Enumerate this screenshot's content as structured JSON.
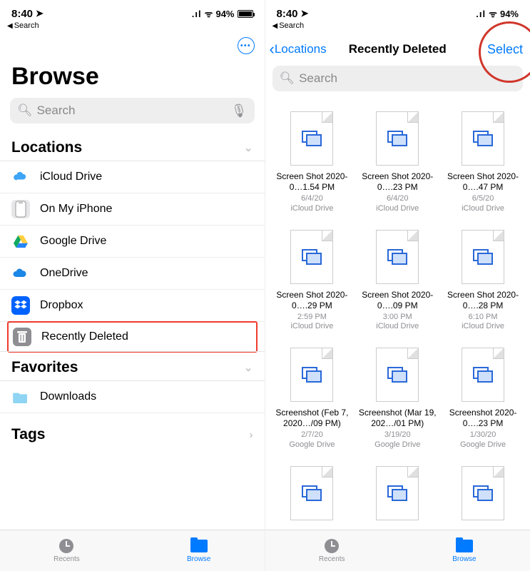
{
  "status": {
    "time": "8:40",
    "back_label": "Search",
    "signal_text": "94%",
    "wifi_glyph": "●",
    "location_glyph": "➤"
  },
  "left": {
    "title": "Browse",
    "search_placeholder": "Search",
    "sections": {
      "locations_title": "Locations",
      "favorites_title": "Favorites",
      "tags_title": "Tags"
    },
    "locations": [
      {
        "label": "iCloud Drive",
        "icon": "cloud"
      },
      {
        "label": "On My iPhone",
        "icon": "phone"
      },
      {
        "label": "Google Drive",
        "icon": "gdrive"
      },
      {
        "label": "OneDrive",
        "icon": "onedrive"
      },
      {
        "label": "Dropbox",
        "icon": "dropbox"
      },
      {
        "label": "Recently Deleted",
        "icon": "trash",
        "highlight": true
      }
    ],
    "favorites": [
      {
        "label": "Downloads",
        "icon": "folder"
      }
    ]
  },
  "right": {
    "back_label": "Locations",
    "title": "Recently Deleted",
    "select_label": "Select",
    "search_placeholder": "Search",
    "files": [
      {
        "name": "Screen Shot 2020-0…1.54 PM",
        "date": "6/4/20",
        "source": "iCloud Drive"
      },
      {
        "name": "Screen Shot 2020-0….23 PM",
        "date": "6/4/20",
        "source": "iCloud Drive"
      },
      {
        "name": "Screen Shot 2020-0….47 PM",
        "date": "6/5/20",
        "source": "iCloud Drive"
      },
      {
        "name": "Screen Shot 2020-0….29 PM",
        "date": "2:59 PM",
        "source": "iCloud Drive"
      },
      {
        "name": "Screen Shot 2020-0….09 PM",
        "date": "3:00 PM",
        "source": "iCloud Drive"
      },
      {
        "name": "Screen Shot 2020-0….28 PM",
        "date": "6:10 PM",
        "source": "iCloud Drive"
      },
      {
        "name": "Screenshot (Feb 7, 2020…/09 PM)",
        "date": "2/7/20",
        "source": "Google Drive"
      },
      {
        "name": "Screenshot (Mar 19, 202…/01 PM)",
        "date": "3/19/20",
        "source": "Google Drive"
      },
      {
        "name": "Screenshot 2020-0….23 PM",
        "date": "1/30/20",
        "source": "Google Drive"
      },
      {
        "name": "",
        "date": "",
        "source": ""
      },
      {
        "name": "",
        "date": "",
        "source": ""
      },
      {
        "name": "",
        "date": "",
        "source": ""
      }
    ]
  },
  "tabbar": {
    "recents": "Recents",
    "browse": "Browse"
  }
}
